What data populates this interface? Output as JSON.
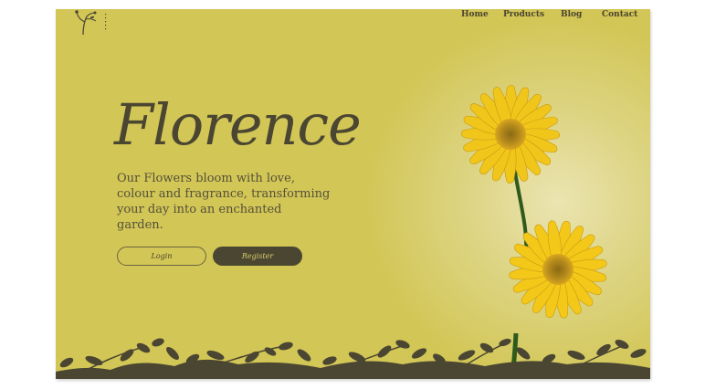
{
  "brand": {
    "icon": "flower-branch-logo"
  },
  "nav": {
    "items": [
      {
        "label": "Home"
      },
      {
        "label": "Products"
      },
      {
        "label": "Blog"
      },
      {
        "label": "Contact"
      }
    ]
  },
  "hero": {
    "title": "Florence",
    "tagline": "Our Flowers bloom with love, colour and fragrance, transforming your day into an enchanted garden.",
    "login_label": "Login",
    "register_label": "Register"
  },
  "colors": {
    "background": "#d2c656",
    "text_dark": "#4b4632",
    "flower_yellow": "#f2c81c",
    "flower_center": "#b8860b"
  },
  "images": {
    "flowers": "yellow-gerbera-daisies",
    "footer_border": "silhouette-leaves-border"
  }
}
